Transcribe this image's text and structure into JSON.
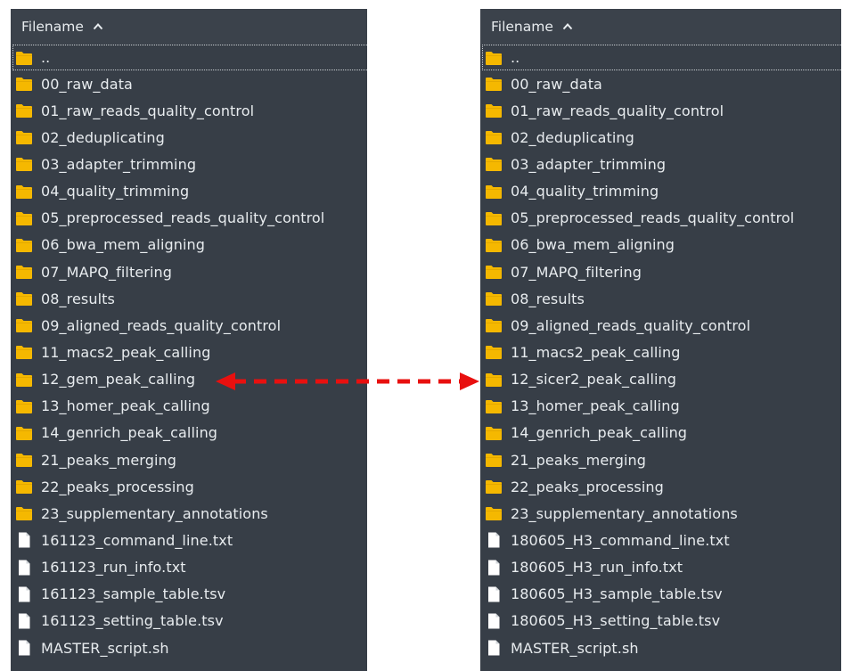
{
  "left_panel": {
    "header": "Filename",
    "rows": [
      {
        "name": "..",
        "icon": "folder-icon"
      },
      {
        "name": "00_raw_data",
        "icon": "folder-icon"
      },
      {
        "name": "01_raw_reads_quality_control",
        "icon": "folder-icon"
      },
      {
        "name": "02_deduplicating",
        "icon": "folder-icon"
      },
      {
        "name": "03_adapter_trimming",
        "icon": "folder-icon"
      },
      {
        "name": "04_quality_trimming",
        "icon": "folder-icon"
      },
      {
        "name": "05_preprocessed_reads_quality_control",
        "icon": "folder-icon"
      },
      {
        "name": "06_bwa_mem_aligning",
        "icon": "folder-icon"
      },
      {
        "name": "07_MAPQ_filtering",
        "icon": "folder-icon"
      },
      {
        "name": "08_results",
        "icon": "folder-icon"
      },
      {
        "name": "09_aligned_reads_quality_control",
        "icon": "folder-icon"
      },
      {
        "name": "11_macs2_peak_calling",
        "icon": "folder-icon"
      },
      {
        "name": "12_gem_peak_calling",
        "icon": "folder-icon"
      },
      {
        "name": "13_homer_peak_calling",
        "icon": "folder-icon"
      },
      {
        "name": "14_genrich_peak_calling",
        "icon": "folder-icon"
      },
      {
        "name": "21_peaks_merging",
        "icon": "folder-icon"
      },
      {
        "name": "22_peaks_processing",
        "icon": "folder-icon"
      },
      {
        "name": "23_supplementary_annotations",
        "icon": "folder-icon"
      },
      {
        "name": "161123_command_line.txt",
        "icon": "file-icon"
      },
      {
        "name": "161123_run_info.txt",
        "icon": "file-icon"
      },
      {
        "name": "161123_sample_table.tsv",
        "icon": "file-icon"
      },
      {
        "name": "161123_setting_table.tsv",
        "icon": "file-icon"
      },
      {
        "name": "MASTER_script.sh",
        "icon": "file-icon"
      }
    ]
  },
  "right_panel": {
    "header": "Filename",
    "rows": [
      {
        "name": "..",
        "icon": "folder-icon"
      },
      {
        "name": "00_raw_data",
        "icon": "folder-icon"
      },
      {
        "name": "01_raw_reads_quality_control",
        "icon": "folder-icon"
      },
      {
        "name": "02_deduplicating",
        "icon": "folder-icon"
      },
      {
        "name": "03_adapter_trimming",
        "icon": "folder-icon"
      },
      {
        "name": "04_quality_trimming",
        "icon": "folder-icon"
      },
      {
        "name": "05_preprocessed_reads_quality_control",
        "icon": "folder-icon"
      },
      {
        "name": "06_bwa_mem_aligning",
        "icon": "folder-icon"
      },
      {
        "name": "07_MAPQ_filtering",
        "icon": "folder-icon"
      },
      {
        "name": "08_results",
        "icon": "folder-icon"
      },
      {
        "name": "09_aligned_reads_quality_control",
        "icon": "folder-icon"
      },
      {
        "name": "11_macs2_peak_calling",
        "icon": "folder-icon"
      },
      {
        "name": "12_sicer2_peak_calling",
        "icon": "folder-icon"
      },
      {
        "name": "13_homer_peak_calling",
        "icon": "folder-icon"
      },
      {
        "name": "14_genrich_peak_calling",
        "icon": "folder-icon"
      },
      {
        "name": "21_peaks_merging",
        "icon": "folder-icon"
      },
      {
        "name": "22_peaks_processing",
        "icon": "folder-icon"
      },
      {
        "name": "23_supplementary_annotations",
        "icon": "folder-icon"
      },
      {
        "name": "180605_H3_command_line.txt",
        "icon": "file-icon"
      },
      {
        "name": "180605_H3_run_info.txt",
        "icon": "file-icon"
      },
      {
        "name": "180605_H3_sample_table.tsv",
        "icon": "file-icon"
      },
      {
        "name": "180605_H3_setting_table.tsv",
        "icon": "file-icon"
      },
      {
        "name": "MASTER_script.sh",
        "icon": "file-icon"
      }
    ]
  },
  "colors": {
    "panel_bg": "#373e47",
    "text": "#e8ecef",
    "folder": "#f5b800",
    "file": "#ffffff",
    "arrow": "#e8100f"
  },
  "annotation": {
    "icon": "double-arrow-icon"
  }
}
